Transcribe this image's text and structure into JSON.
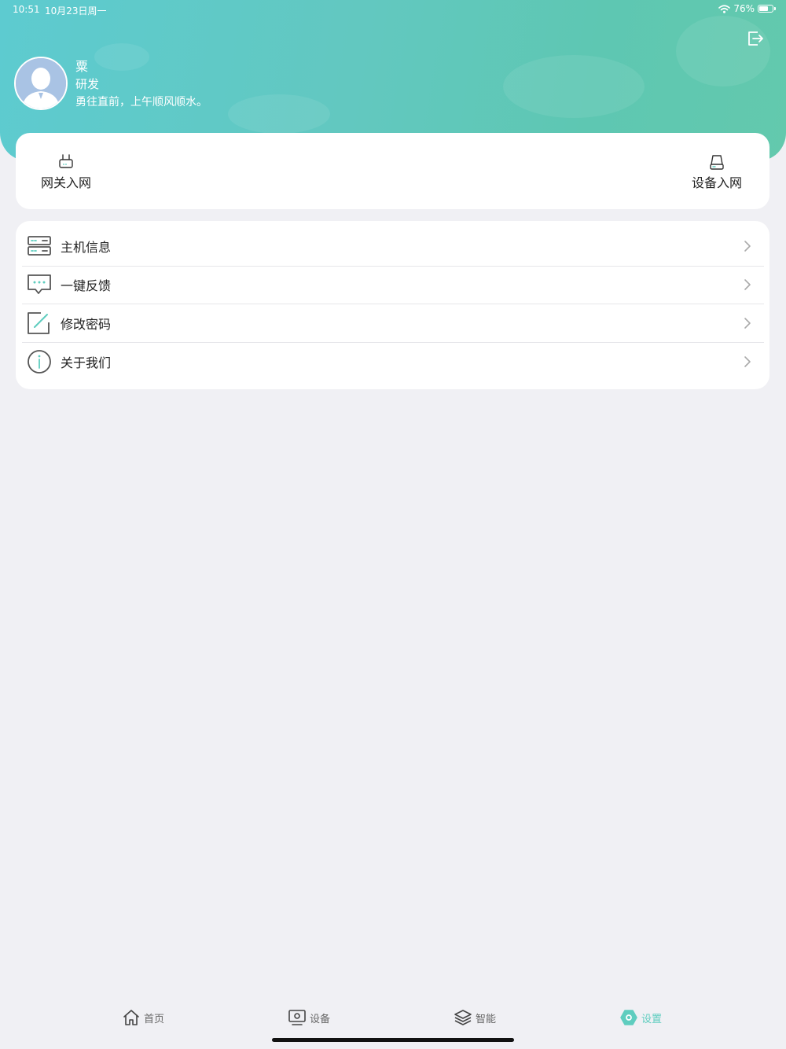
{
  "status_bar": {
    "time": "10:51",
    "date": "10月23日周一",
    "battery": "76%",
    "battery_level": 0.76
  },
  "profile": {
    "name": "粟",
    "department": "研发",
    "motto": "勇往直前，上午顺风顺水。"
  },
  "quick_actions": {
    "gateway_label": "网关入网",
    "device_label": "设备入网"
  },
  "menu": {
    "items": [
      {
        "label": "主机信息",
        "icon": "server-icon"
      },
      {
        "label": "一键反馈",
        "icon": "chat-bubble-icon"
      },
      {
        "label": "修改密码",
        "icon": "edit-icon"
      },
      {
        "label": "关于我们",
        "icon": "info-icon"
      }
    ]
  },
  "tabbar": {
    "tabs": [
      {
        "label": "首页",
        "icon": "home-icon"
      },
      {
        "label": "设备",
        "icon": "monitor-icon"
      },
      {
        "label": "智能",
        "icon": "layers-icon"
      },
      {
        "label": "设置",
        "icon": "hexagon-gear-icon",
        "active": true
      }
    ]
  },
  "colors": {
    "accent": "#5fcdbf",
    "header_start": "#5dcbd0",
    "header_end": "#63c9ad",
    "background": "#f0f0f4"
  }
}
